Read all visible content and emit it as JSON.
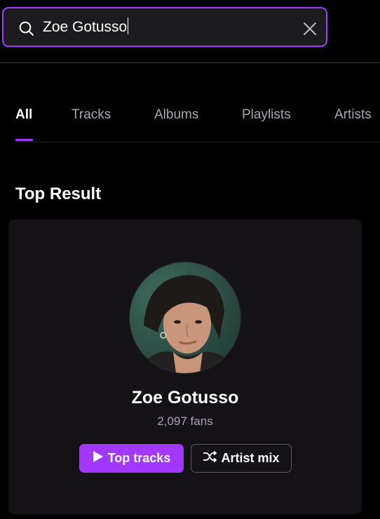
{
  "search": {
    "value": "Zoe Gotusso",
    "placeholder": "Search",
    "icon": "search-icon",
    "clear_icon": "close-icon"
  },
  "tabs": [
    {
      "label": "All",
      "active": true
    },
    {
      "label": "Tracks",
      "active": false
    },
    {
      "label": "Albums",
      "active": false
    },
    {
      "label": "Playlists",
      "active": false
    },
    {
      "label": "Artists",
      "active": false
    }
  ],
  "top_result": {
    "section_title": "Top Result",
    "artist_name": "Zoe Gotusso",
    "fans": "2,097 fans",
    "buttons": {
      "top_tracks": "Top tracks",
      "artist_mix": "Artist mix"
    }
  },
  "colors": {
    "accent": "#a238ff",
    "background": "#000000",
    "card": "#141216",
    "muted_text": "#a6a6b0"
  }
}
